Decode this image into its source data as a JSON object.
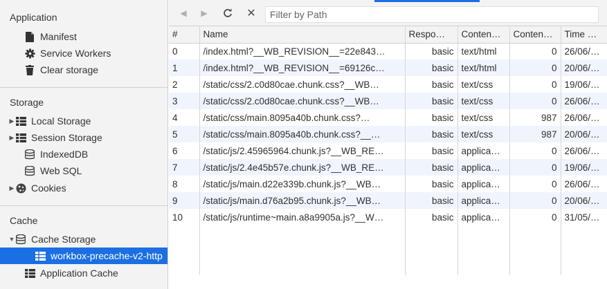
{
  "sidebar": {
    "application": {
      "title": "Application",
      "items": [
        {
          "label": "Manifest",
          "icon": "document-icon"
        },
        {
          "label": "Service Workers",
          "icon": "gear-icon"
        },
        {
          "label": "Clear storage",
          "icon": "trash-icon"
        }
      ]
    },
    "storage": {
      "title": "Storage",
      "items": [
        {
          "label": "Local Storage",
          "icon": "grid-icon",
          "expandable": true
        },
        {
          "label": "Session Storage",
          "icon": "grid-icon",
          "expandable": true
        },
        {
          "label": "IndexedDB",
          "icon": "database-icon",
          "expandable": false
        },
        {
          "label": "Web SQL",
          "icon": "database-icon",
          "expandable": false
        },
        {
          "label": "Cookies",
          "icon": "cookie-icon",
          "expandable": true
        }
      ]
    },
    "cache": {
      "title": "Cache",
      "items": [
        {
          "label": "Cache Storage",
          "icon": "database-icon",
          "expanded": true
        },
        {
          "label": "workbox-precache-v2-http",
          "icon": "grid-icon",
          "selected": true
        },
        {
          "label": "Application Cache",
          "icon": "grid-icon"
        }
      ]
    }
  },
  "toolbar": {
    "back_icon": "◀",
    "forward_icon": "▶",
    "refresh_icon": "C",
    "clear_icon": "✕",
    "filter_placeholder": "Filter by Path"
  },
  "table": {
    "columns": [
      "#",
      "Name",
      "Respo…",
      "Conten…",
      "Conten…",
      "Time C…"
    ],
    "rows": [
      [
        "0",
        "/index.html?__WB_REVISION__=22e843…",
        "basic",
        "text/html",
        "0",
        "26/06/…"
      ],
      [
        "1",
        "/index.html?__WB_REVISION__=69126c…",
        "basic",
        "text/html",
        "0",
        "20/06/…"
      ],
      [
        "2",
        "/static/css/2.c0d80cae.chunk.css?__WB…",
        "basic",
        "text/css",
        "0",
        "19/06/…"
      ],
      [
        "3",
        "/static/css/2.c0d80cae.chunk.css?__WB…",
        "basic",
        "text/css",
        "0",
        "26/06/…"
      ],
      [
        "4",
        "/static/css/main.8095a40b.chunk.css?…",
        "basic",
        "text/css",
        "987",
        "26/06/…"
      ],
      [
        "5",
        "/static/css/main.8095a40b.chunk.css?__…",
        "basic",
        "text/css",
        "987",
        "20/06/…"
      ],
      [
        "6",
        "/static/js/2.45965964.chunk.js?__WB_RE…",
        "basic",
        "applica…",
        "0",
        "26/06/…"
      ],
      [
        "7",
        "/static/js/2.4e45b57e.chunk.js?__WB_RE…",
        "basic",
        "applica…",
        "0",
        "19/06/…"
      ],
      [
        "8",
        "/static/js/main.d22e339b.chunk.js?__WB…",
        "basic",
        "applica…",
        "0",
        "26/06/…"
      ],
      [
        "9",
        "/static/js/main.d76a2b95.chunk.js?__WB…",
        "basic",
        "applica…",
        "0",
        "20/06/…"
      ],
      [
        "10",
        "/static/js/runtime~main.a8a9905a.js?__W…",
        "basic",
        "applica…",
        "0",
        "31/05/…"
      ]
    ]
  },
  "colors": {
    "selection": "#1b6fe3",
    "alt_row": "#f0f5fd",
    "panel_bg": "#f3f3f3"
  }
}
